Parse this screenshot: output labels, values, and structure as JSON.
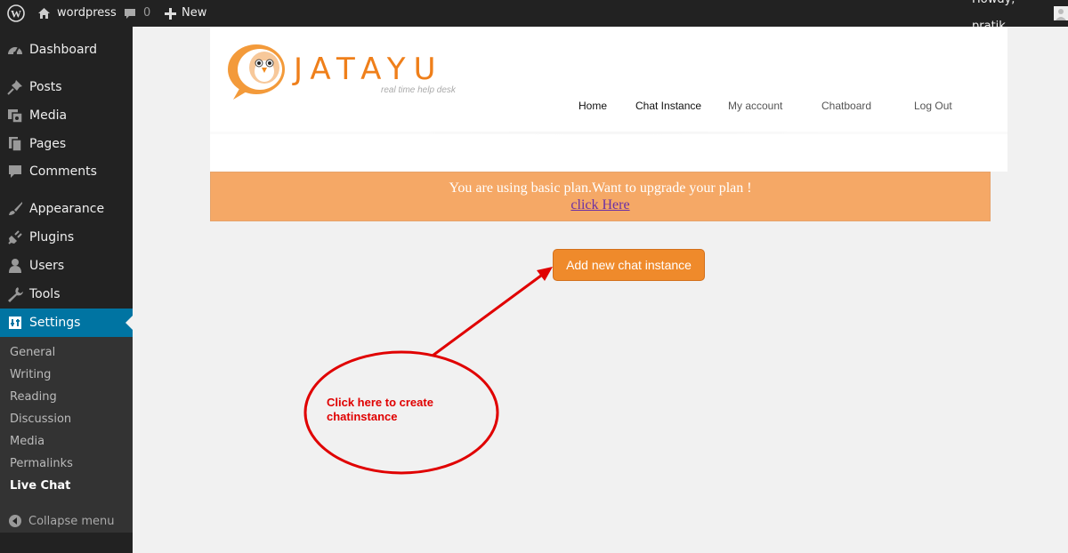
{
  "adminbar": {
    "site_name": "wordpress",
    "comments_count": "0",
    "new_label": "New",
    "howdy": "Howdy, pratik"
  },
  "sidebar": {
    "items": [
      {
        "label": "Dashboard",
        "icon": "dashboard-icon"
      },
      {
        "label": "Posts",
        "icon": "pin-icon"
      },
      {
        "label": "Media",
        "icon": "media-icon"
      },
      {
        "label": "Pages",
        "icon": "pages-icon"
      },
      {
        "label": "Comments",
        "icon": "comment-icon"
      },
      {
        "label": "Appearance",
        "icon": "brush-icon"
      },
      {
        "label": "Plugins",
        "icon": "plug-icon"
      },
      {
        "label": "Users",
        "icon": "user-icon"
      },
      {
        "label": "Tools",
        "icon": "wrench-icon"
      },
      {
        "label": "Settings",
        "icon": "settings-icon"
      }
    ],
    "submenu": [
      "General",
      "Writing",
      "Reading",
      "Discussion",
      "Media",
      "Permalinks",
      "Live Chat"
    ],
    "collapse_label": "Collapse menu"
  },
  "plugin": {
    "logo_text": "JATAYU",
    "logo_tagline": "real time help desk",
    "nav": [
      "Home",
      "Chat Instance",
      "My account",
      "Chatboard",
      "Log Out"
    ],
    "notice_text": "You are using basic plan.Want to upgrade your plan !",
    "notice_link": "click Here",
    "add_button": "Add new chat instance"
  },
  "annotation": {
    "line1": "Click here to create",
    "line2": "chatinstance",
    "color": "#e00000"
  },
  "colors": {
    "admin_dark": "#222222",
    "active_blue": "#0074a2",
    "orange": "#ef8a2b",
    "notice_bg": "#f5a866"
  }
}
